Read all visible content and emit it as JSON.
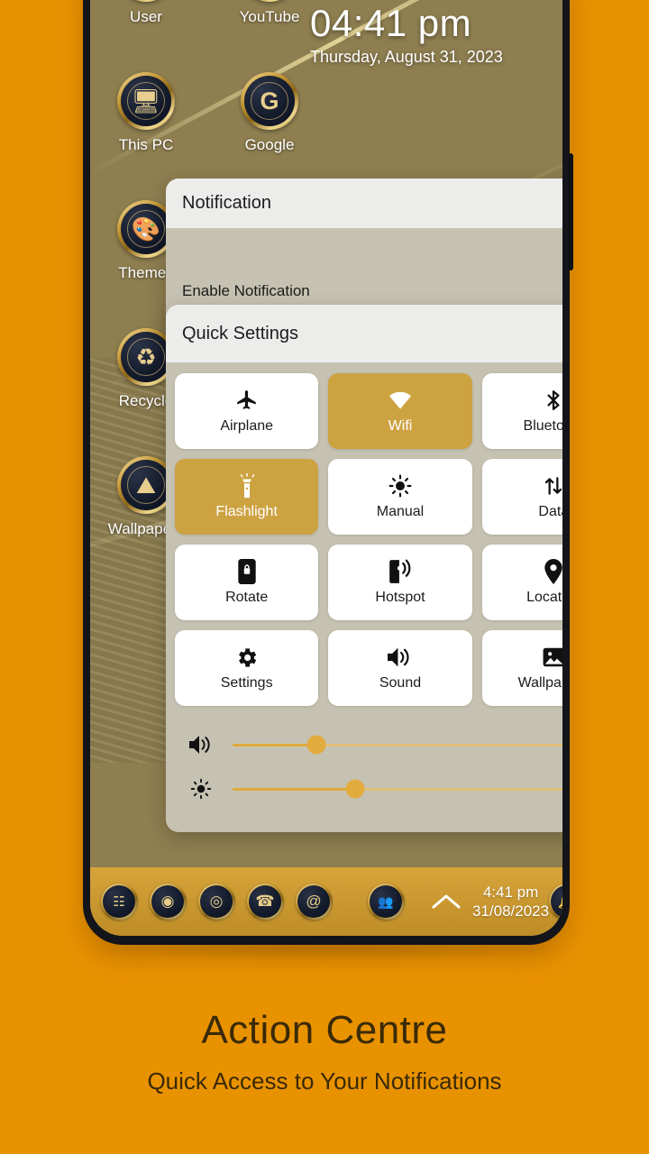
{
  "background_color": "#e99200",
  "accent_color": "#cda241",
  "desktop": {
    "icons": [
      {
        "label": "User",
        "icon": "user-icon",
        "glyph": "☺"
      },
      {
        "label": "YouTube",
        "icon": "youtube-icon",
        "glyph": "▶"
      },
      {
        "label": "This PC",
        "icon": "computer-icon",
        "glyph": "☐"
      },
      {
        "label": "Google",
        "icon": "google-g-icon",
        "glyph": "G"
      },
      {
        "label": "Themes",
        "icon": "palette-icon",
        "glyph": "◕"
      },
      {
        "label": "Recycle",
        "icon": "recycle-bin-icon",
        "glyph": "♻"
      },
      {
        "label": "Wallpapers",
        "icon": "image-icon",
        "glyph": "⛰"
      }
    ]
  },
  "clock_widget": {
    "time": "04:41 pm",
    "date": "Thursday, August 31, 2023"
  },
  "notification_panel": {
    "header": "Notification",
    "row_label": "Enable Notification",
    "toggle_state": "off"
  },
  "quick_settings": {
    "header": "Quick Settings",
    "collapse_icon": "chevron-down-icon",
    "tiles": [
      {
        "label": "Airplane",
        "icon": "airplane-icon",
        "active": false
      },
      {
        "label": "Wifi",
        "icon": "wifi-icon",
        "active": true
      },
      {
        "label": "Bluetooth",
        "icon": "bluetooth-icon",
        "active": false
      },
      {
        "label": "Flashlight",
        "icon": "flashlight-icon",
        "active": true
      },
      {
        "label": "Manual",
        "icon": "brightness-icon",
        "active": false
      },
      {
        "label": "Data",
        "icon": "data-transfer-icon",
        "active": false
      },
      {
        "label": "Rotate",
        "icon": "rotate-lock-icon",
        "active": false
      },
      {
        "label": "Hotspot",
        "icon": "hotspot-icon",
        "active": false
      },
      {
        "label": "Location",
        "icon": "location-pin-icon",
        "active": false
      },
      {
        "label": "Settings",
        "icon": "gear-icon",
        "active": false
      },
      {
        "label": "Sound",
        "icon": "speaker-icon",
        "active": false
      },
      {
        "label": "Wallpapers",
        "icon": "picture-icon",
        "active": false
      }
    ],
    "sliders": [
      {
        "name": "volume-slider",
        "icon": "volume-icon",
        "value": 22
      },
      {
        "name": "brightness-slider",
        "icon": "brightness-icon",
        "value": 32
      }
    ]
  },
  "taskbar": {
    "icons": [
      {
        "name": "app-drawer-icon",
        "glyph": "∷"
      },
      {
        "name": "record-icon",
        "glyph": "◉"
      },
      {
        "name": "chrome-icon",
        "glyph": "◎"
      },
      {
        "name": "phone-icon",
        "glyph": "☎"
      },
      {
        "name": "email-icon",
        "glyph": "@"
      },
      {
        "name": "contacts-icon",
        "glyph": "♟"
      }
    ],
    "expand_icon": "chevron-up-icon",
    "time": "4:41 pm",
    "date": "31/08/2023",
    "notification_icon": "bell-icon"
  },
  "caption": {
    "title": "Action Centre",
    "subtitle": "Quick Access to Your Notifications"
  }
}
